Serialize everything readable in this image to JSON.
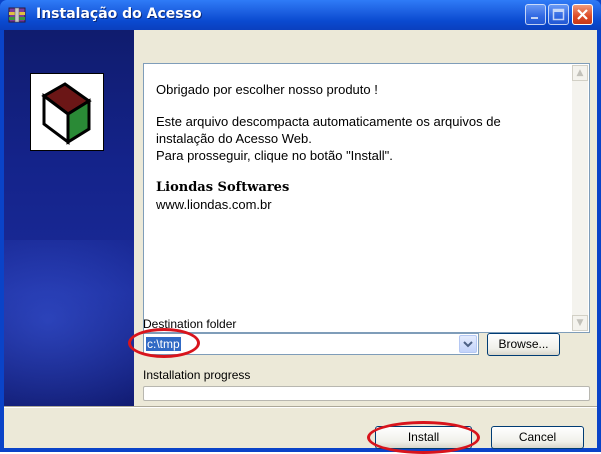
{
  "window": {
    "title": "Instalação do Acesso",
    "title_icon": "winrar-sfx-icon"
  },
  "message": {
    "line1": "Obrigado por escolher nosso produto !",
    "line2": "Este arquivo descompacta automaticamente os arquivos de",
    "line3": "instalação do Acesso Web.",
    "line4": "Para prosseguir, clique no botão \"Install\".",
    "company": "Liondas Softwares",
    "website": "www.liondas.com.br"
  },
  "destination": {
    "label": "Destination folder",
    "value": "c:\\tmp",
    "browse_label": "Browse..."
  },
  "progress": {
    "label": "Installation progress",
    "value": 0
  },
  "buttons": {
    "install": "Install",
    "cancel": "Cancel"
  },
  "colors": {
    "titlebar": "#0a4ad0",
    "annotation": "#d8141c",
    "selection": "#316ac5"
  }
}
